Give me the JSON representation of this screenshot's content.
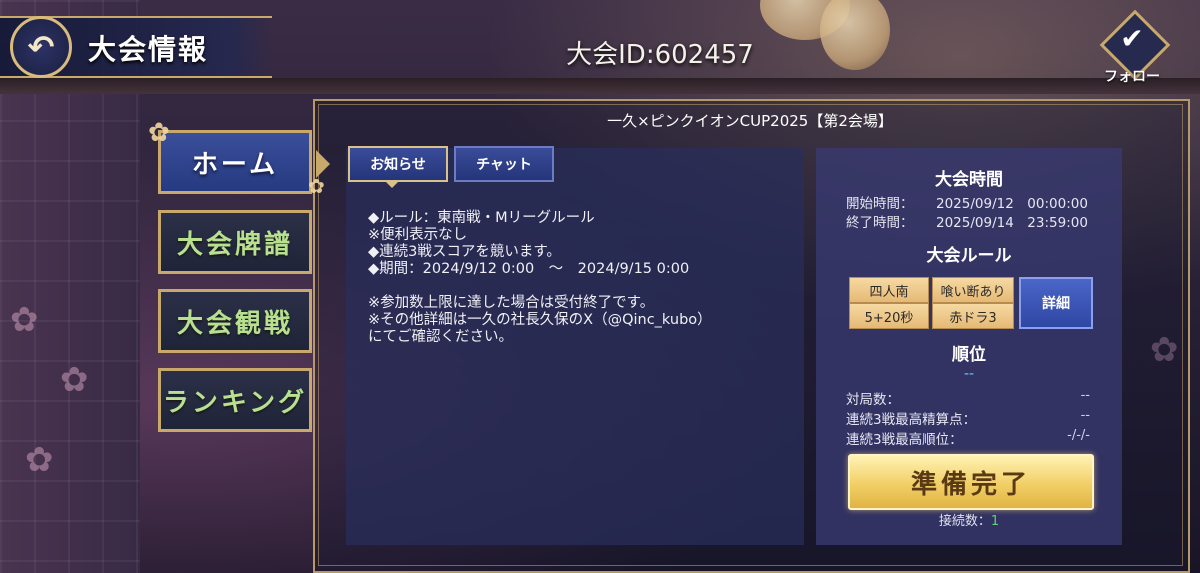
{
  "header": {
    "title": "大会情報",
    "tournament_id": "大会ID:602457",
    "follow_label": "フォロー"
  },
  "cup_title": "一久×ピンクイオンCUP2025【第2会場】",
  "nav": [
    {
      "label": "ホーム",
      "active": true
    },
    {
      "label": "大会牌譜",
      "active": false
    },
    {
      "label": "大会観戦",
      "active": false
    },
    {
      "label": "ランキング",
      "active": false
    }
  ],
  "tabs": [
    {
      "label": "お知らせ",
      "active": true
    },
    {
      "label": "チャット",
      "active": false
    }
  ],
  "notice": [
    "◆ルール：東南戦・Mリーグルール",
    "※便利表示なし",
    "◆連続3戦スコアを競います。",
    "◆期間：2024/9/12 0:00　～　2024/9/15 0:00",
    "",
    "※参加数上限に達した場合は受付終了です。",
    "※その他詳細は一久の社長久保のX（@Qinc_kubo）",
    "にてご確認ください。"
  ],
  "schedule": {
    "heading": "大会時間",
    "start_label": "開始時間：",
    "start_value": "2025/09/12　00:00:00",
    "end_label": "終了時間：",
    "end_value": "2025/09/14　23:59:00"
  },
  "rules": {
    "heading": "大会ルール",
    "tags": [
      "四人南",
      "喰い断あり",
      "5+20秒",
      "赤ドラ3"
    ],
    "detail_label": "詳細"
  },
  "ranking": {
    "heading": "順位",
    "value": "--",
    "stats": [
      {
        "label": "対局数：",
        "value": "--"
      },
      {
        "label": "連続3戦最高精算点：",
        "value": "--"
      },
      {
        "label": "連続3戦最高順位：",
        "value": "-/-/-"
      }
    ]
  },
  "ready_label": "準備完了",
  "connection": {
    "label": "接続数：",
    "value": "1"
  },
  "colors": {
    "accent_gold": "#c9a86b",
    "ready_yellow": "#f1cf66",
    "nav_text_green": "#b7e08f"
  }
}
